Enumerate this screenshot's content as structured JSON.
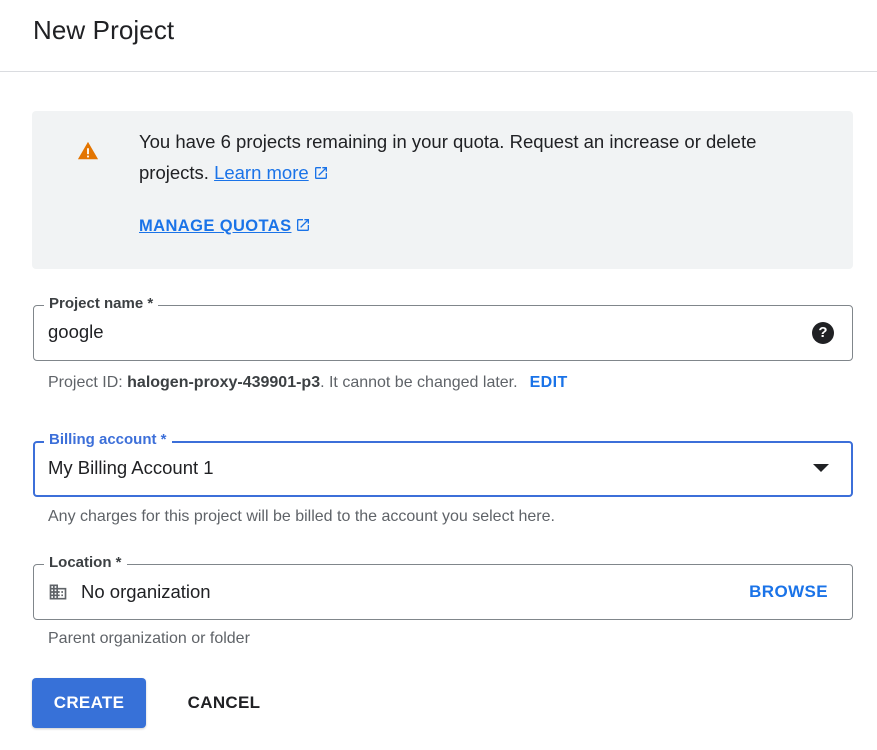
{
  "header": {
    "title": "New Project"
  },
  "quota_notice": {
    "icon": "warning-icon",
    "accent_color": "#e37400",
    "message": "You have 6 projects remaining in your quota. Request an increase or delete projects.",
    "learn_more_label": "Learn more",
    "manage_quotas_label": "MANAGE QUOTAS"
  },
  "project_name": {
    "label": "Project name *",
    "value": "google",
    "help_icon": "help-icon"
  },
  "project_id": {
    "prefix": "Project ID: ",
    "id": "halogen-proxy-439901-p3",
    "suffix": ". It cannot be changed later.",
    "edit_label": "EDIT"
  },
  "billing": {
    "label": "Billing account *",
    "value": "My Billing Account 1",
    "hint": "Any charges for this project will be billed to the account you select here.",
    "focus_color": "#3c6fd9"
  },
  "location": {
    "label": "Location *",
    "value": "No organization",
    "icon": "building-icon",
    "browse_label": "BROWSE",
    "hint": "Parent organization or folder"
  },
  "actions": {
    "create_label": "CREATE",
    "cancel_label": "CANCEL",
    "primary_color": "#3771d8"
  }
}
